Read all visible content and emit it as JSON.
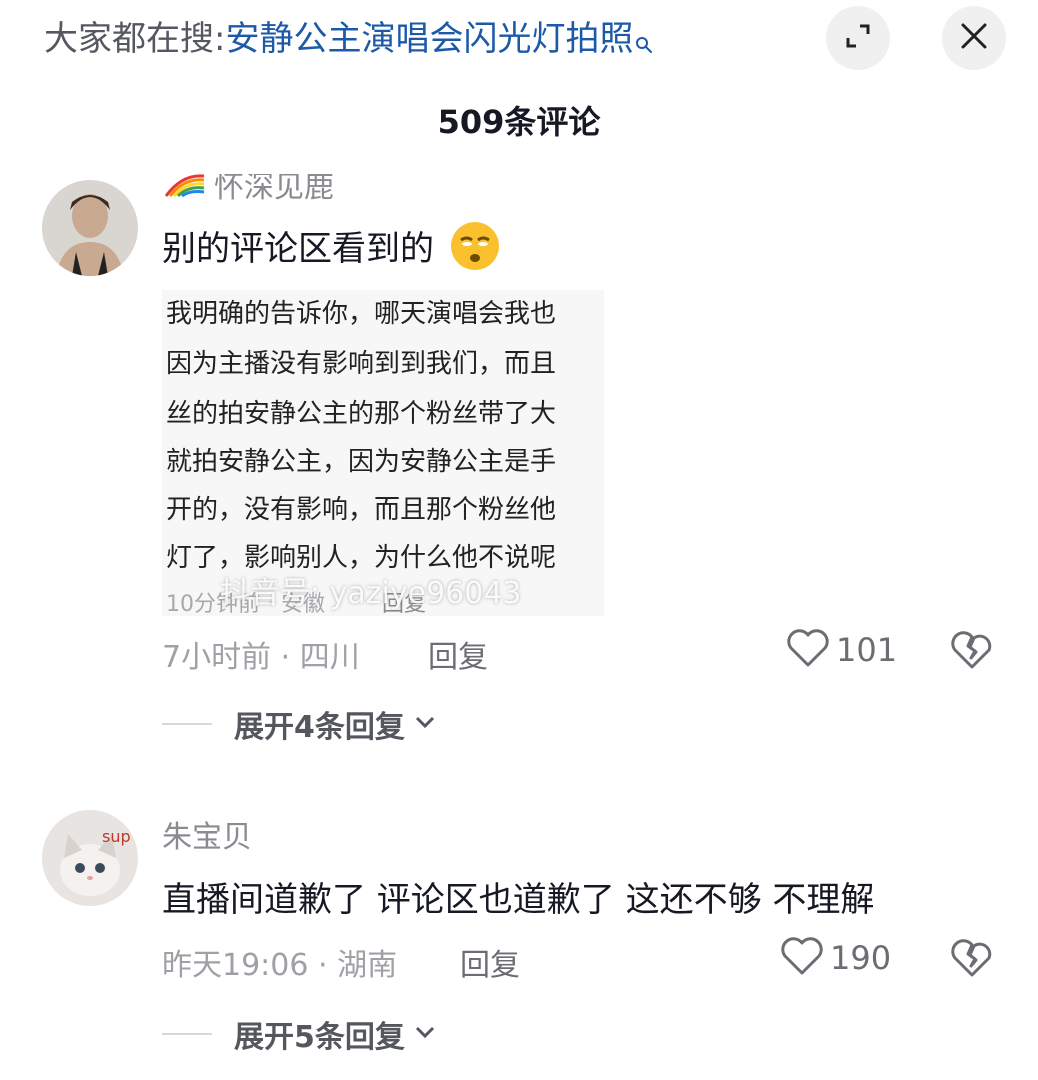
{
  "header": {
    "search_prefix": "大家都在搜:",
    "search_query": "安静公主演唱会闪光灯拍照",
    "comment_count": "509条评论"
  },
  "comments": [
    {
      "badge_icon": "rainbow-icon",
      "username": "怀深见鹿",
      "text": "别的评论区看到的",
      "emoji": "smirk-face",
      "screenshot": {
        "lines": [
          "我明确的告诉你，哪天演唱会我也",
          "因为主播没有影响到到我们，而且",
          "丝的拍安静公主的那个粉丝带了大",
          "就拍安静公主，因为安静公主是手",
          "开的，没有影响，而且那个粉丝他",
          "灯了，影响别人，为什么他不说呢"
        ],
        "meta": "10分钟前 · 安徽",
        "reply": "回复"
      },
      "watermark": "抖音号: yaziye96043",
      "meta": "7小时前 · 四川",
      "reply_label": "回复",
      "likes": "101",
      "expand_label": "展开4条回复"
    },
    {
      "username": "朱宝贝",
      "text": "直播间道歉了 评论区也道歉了 这还不够 不理解",
      "meta": "昨天19:06 · 湖南",
      "reply_label": "回复",
      "likes": "190",
      "expand_label": "展开5条回复"
    }
  ],
  "colors": {
    "query_blue": "#1c5aa8",
    "meta_gray": "#a0a1a6",
    "text_dark": "#161823"
  }
}
